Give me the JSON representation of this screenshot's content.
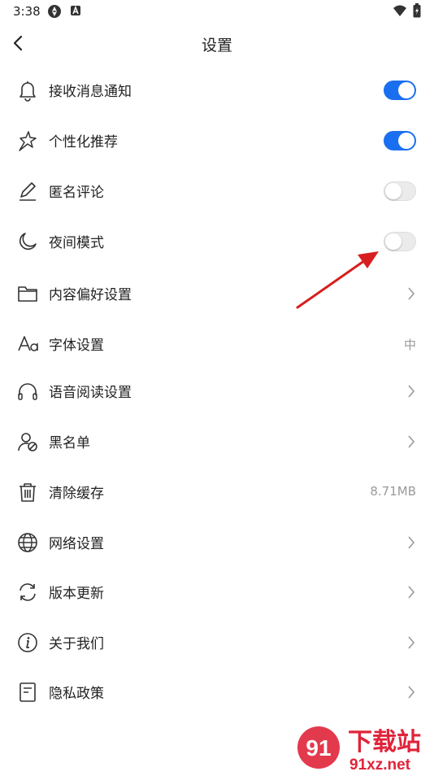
{
  "status_bar": {
    "time": "3:38"
  },
  "header": {
    "title": "设置"
  },
  "settings": [
    {
      "label": "接收消息通知",
      "icon": "bell-icon",
      "control": "toggle",
      "toggle_on": true
    },
    {
      "label": "个性化推荐",
      "icon": "sparkle-star-icon",
      "control": "toggle",
      "toggle_on": true
    },
    {
      "label": "匿名评论",
      "icon": "pencil-icon",
      "control": "toggle",
      "toggle_on": false
    },
    {
      "label": "夜间模式",
      "icon": "moon-icon",
      "control": "toggle",
      "toggle_on": false
    },
    {
      "label": "内容偏好设置",
      "icon": "folder-icon",
      "control": "chevron"
    },
    {
      "label": "字体设置",
      "icon": "font-aa-icon",
      "control": "value",
      "value": "中"
    },
    {
      "label": "语音阅读设置",
      "icon": "headphones-icon",
      "control": "chevron"
    },
    {
      "label": "黑名单",
      "icon": "user-block-icon",
      "control": "chevron"
    },
    {
      "label": "清除缓存",
      "icon": "trash-icon",
      "control": "value",
      "value": "8.71MB"
    },
    {
      "label": "网络设置",
      "icon": "globe-icon",
      "control": "chevron"
    },
    {
      "label": "版本更新",
      "icon": "refresh-icon",
      "control": "chevron"
    },
    {
      "label": "关于我们",
      "icon": "info-icon",
      "control": "chevron"
    },
    {
      "label": "隐私政策",
      "icon": "document-icon",
      "control": "chevron"
    }
  ],
  "watermark": {
    "text": "下载站",
    "domain": "91xz.net",
    "logo_text": "91"
  },
  "colors": {
    "toggle_on": "#1a6ff0",
    "toggle_off": "#ebebeb",
    "annotation_arrow": "#d81e1e",
    "watermark_red": "#e0243a"
  }
}
